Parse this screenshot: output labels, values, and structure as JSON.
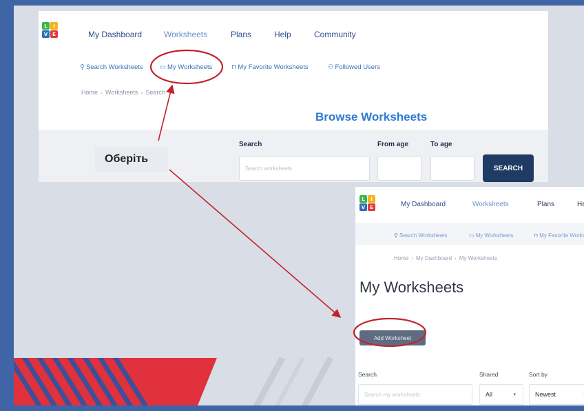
{
  "logo": {
    "letters": [
      "L",
      "I",
      "V",
      "E"
    ]
  },
  "top": {
    "nav": [
      "My Dashboard",
      "Worksheets",
      "Plans",
      "Help",
      "Community"
    ],
    "subnav": [
      {
        "icon": "search-icon",
        "label": "Search Worksheets"
      },
      {
        "icon": "book-icon",
        "label": "My Worksheets"
      },
      {
        "icon": "bookmark-icon",
        "label": "My Favorite Worksheets"
      },
      {
        "icon": "user-icon",
        "label": "Followed Users"
      }
    ],
    "breadcrumb": [
      "Home",
      "Worksheets",
      "Search"
    ],
    "title": "Browse Worksheets",
    "filters": {
      "search_label": "Search",
      "search_placeholder": "Search worksheets",
      "from_age_label": "From age",
      "to_age_label": "To age",
      "search_button": "SEARCH"
    }
  },
  "callout": {
    "text": "Оберіть"
  },
  "bottom": {
    "nav": [
      "My Dashboard",
      "Worksheets",
      "Plans",
      "Help"
    ],
    "subnav": [
      "Search Worksheets",
      "My Worksheets",
      "My Favorite Works"
    ],
    "breadcrumb": [
      "Home",
      "My Dashboard",
      "My Worksheets"
    ],
    "title": "My Worksheets",
    "add_button": "Add Worksheet",
    "filters": {
      "search_label": "Search",
      "search_placeholder": "Search my worksheets",
      "shared_label": "Shared",
      "shared_value": "All",
      "sort_label": "Sort by",
      "sort_value": "Newest"
    }
  },
  "colors": {
    "frame": "#3f65a6",
    "nav": "#2f4d8c",
    "link": "#3d6fb6",
    "title": "#2f7ad3",
    "primary_button": "#1f3a63",
    "highlight": "#c0242e",
    "stripe_red": "#e0313d"
  }
}
